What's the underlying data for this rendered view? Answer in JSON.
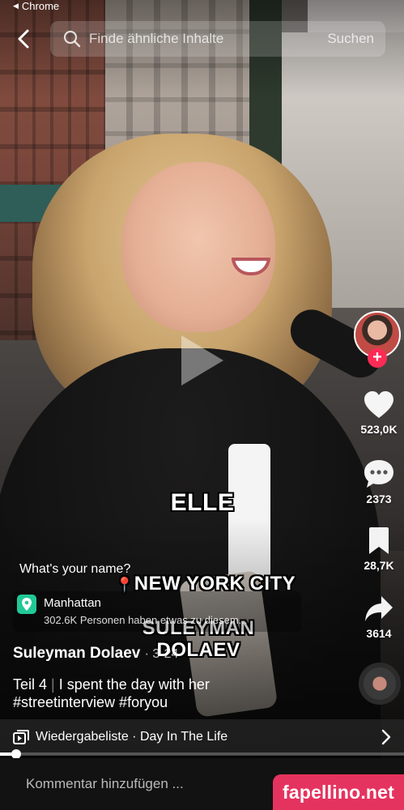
{
  "status_bar": {
    "back_app_label": "Chrome"
  },
  "search": {
    "placeholder": "Finde ähnliche Inhalte",
    "submit_label": "Suchen"
  },
  "video": {
    "overlay_text_name": "ELLE",
    "overlay_text_city": "NEW YORK CITY",
    "overlay_text_credit": "SULEYMAN DOLAEV",
    "question": "What's your name?"
  },
  "actions": {
    "likes": "523,0K",
    "comments": "2373",
    "bookmarks": "28,7K",
    "shares": "3614"
  },
  "location": {
    "name": "Manhattan",
    "subtitle": "302.6K Personen haben etwas zu diesem..."
  },
  "post": {
    "author": "Suleyman Dolaev",
    "date": "· 3-24",
    "caption_part": "Teil 4",
    "caption_separator": "|",
    "caption_text": "I spent the day with her",
    "hashtags": "#streetinterview #foryou"
  },
  "playlist": {
    "label": "Wiedergabeliste · Day In The Life"
  },
  "playback": {
    "progress_fraction": 0.04
  },
  "comment_bar": {
    "placeholder": "Kommentar hinzufügen ..."
  },
  "watermark": {
    "text": "fapellino.net"
  },
  "colors": {
    "accent": "#fe2c55",
    "location_icon": "#20c997",
    "watermark": "#e5335f"
  },
  "icons": [
    "chevron-left-icon",
    "search-icon",
    "play-icon",
    "heart-icon",
    "comment-icon",
    "bookmark-icon",
    "share-icon",
    "location-pin-icon",
    "playlist-icon",
    "chevron-right-icon",
    "at-icon",
    "emoji-icon",
    "gift-icon"
  ]
}
